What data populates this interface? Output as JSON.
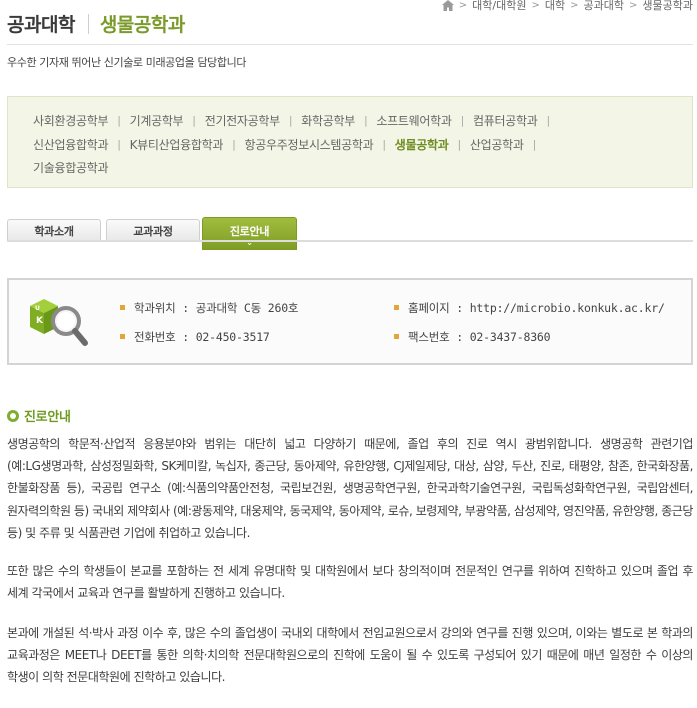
{
  "breadcrumb": {
    "items": [
      "대학/대학원",
      "대학",
      "공과대학",
      "생물공학과"
    ]
  },
  "header": {
    "college": "공과대학",
    "department": "생물공학과",
    "subtitle": "우수한 기자재 뛰어난 신기술로 미래공업을 담당합니다"
  },
  "dept_list": {
    "rows": [
      [
        "사회환경공학부",
        "기계공학부",
        "전기전자공학부",
        "화학공학부",
        "소프트웨어학과",
        "컴퓨터공학과"
      ],
      [
        "신산업융합학과",
        "K뷰티산업융합학과",
        "항공우주정보시스템공학과",
        "생물공학과",
        "산업공학과"
      ],
      [
        "기술융합공학과"
      ]
    ],
    "active": "생물공학과"
  },
  "tabs": [
    {
      "label": "학과소개"
    },
    {
      "label": "교과과정"
    },
    {
      "label": "진로안내"
    }
  ],
  "info": {
    "location": "학과위치 : 공과대학 C동 260호",
    "homepage": "홈페이지 : http://microbio.konkuk.ac.kr/",
    "phone": "전화번호 : 02-450-3517",
    "fax": "팩스번호 : 02-3437-8360",
    "icon_letters": "KU"
  },
  "section": {
    "title": "진로안내",
    "paragraphs": [
      "생명공학의 학문적·산업적 응용분야와 범위는 대단히 넓고 다양하기 때문에, 졸업 후의 진로 역시 광범위합니다. 생명공학 관련기업 (예:LG생명과학, 삼성정밀화학, SK케미칼, 녹십자, 종근당, 동아제약, 유한양행, CJ제일제당, 대상, 삼양, 두산, 진로, 태평양, 참존, 한국화장품, 한불화장품 등), 국공립 연구소 (예:식품의약품안전청, 국립보건원, 생명공학연구원, 한국과학기술연구원, 국립독성화학연구원, 국립암센터, 원자력의학원 등) 국내외 제약회사 (예:광동제약, 대웅제약, 동국제약, 동아제약, 로슈, 보령제약, 부광약품, 삼성제약, 영진약품, 유한양행, 종근당 등) 및 주류 및 식품관련 기업에 취업하고 있습니다.",
      "또한 많은 수의 학생들이 본교를 포함하는 전 세계 유명대학 및 대학원에서 보다 창의적이며 전문적인 연구를 위하여 진학하고 있으며 졸업 후 세계 각국에서 교육과 연구를 활발하게 진행하고 있습니다.",
      "본과에 개설된 석·박사 과정 이수 후, 많은 수의 졸업생이 국내외 대학에서 전임교원으로서 강의와 연구를 진행 있으며, 이와는 별도로 본 학과의 교육과정은 MEET나 DEET를 통한 의학·치의학 전문대학원으로의 진학에 도움이 될 수 있도록 구성되어 있기 때문에 매년 일정한 수 이상의 학생이 의학 전문대학원에 진학하고 있습니다."
    ]
  },
  "colors": {
    "accent": "#7a9a2a",
    "tab_active": "#8aa92e",
    "dept_box_bg": "#f3f6e6",
    "bullet": "#e0a63a"
  }
}
